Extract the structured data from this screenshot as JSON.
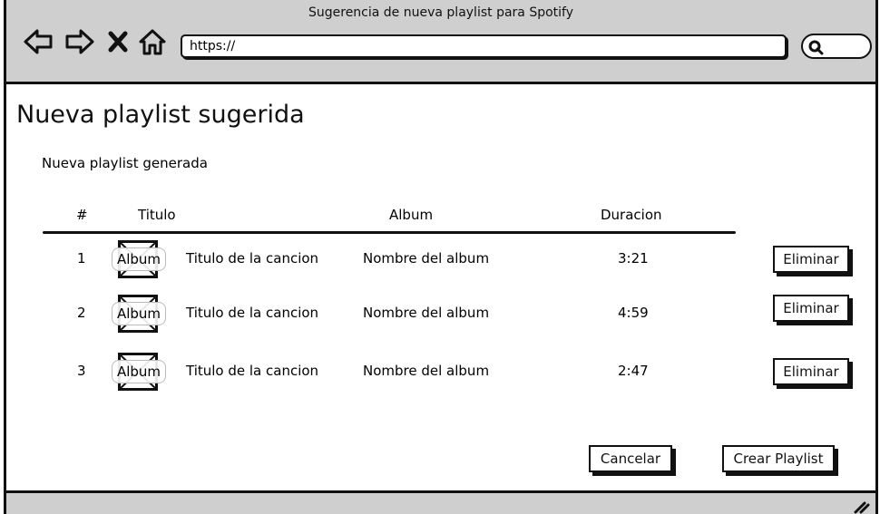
{
  "window": {
    "title": "Sugerencia de nueva playlist para Spotify",
    "url": "https://"
  },
  "toolbar": {
    "icons": [
      "back-arrow-icon",
      "forward-arrow-icon",
      "close-x-icon",
      "home-icon",
      "search-icon"
    ]
  },
  "page": {
    "title": "Nueva playlist sugerida",
    "subtitle": "Nueva playlist generada"
  },
  "table": {
    "headers": {
      "number": "#",
      "title": "Titulo",
      "album": "Album",
      "duration": "Duracion"
    },
    "rows": [
      {
        "number": "1",
        "thumb": "Album",
        "title": "Titulo de la cancion",
        "album": "Nombre del album",
        "duration": "3:21",
        "action": "Eliminar"
      },
      {
        "number": "2",
        "thumb": "Album",
        "title": "Titulo de la cancion",
        "album": "Nombre del album",
        "duration": "4:59",
        "action": "Eliminar"
      },
      {
        "number": "3",
        "thumb": "Album",
        "title": "Titulo de la cancion",
        "album": "Nombre del album",
        "duration": "2:47",
        "action": "Eliminar"
      }
    ]
  },
  "footer": {
    "cancel_label": "Cancelar",
    "create_label": "Crear Playlist"
  },
  "colors": {
    "chrome": "#cfcfcf",
    "ink": "#111111",
    "background": "#ffffff"
  }
}
